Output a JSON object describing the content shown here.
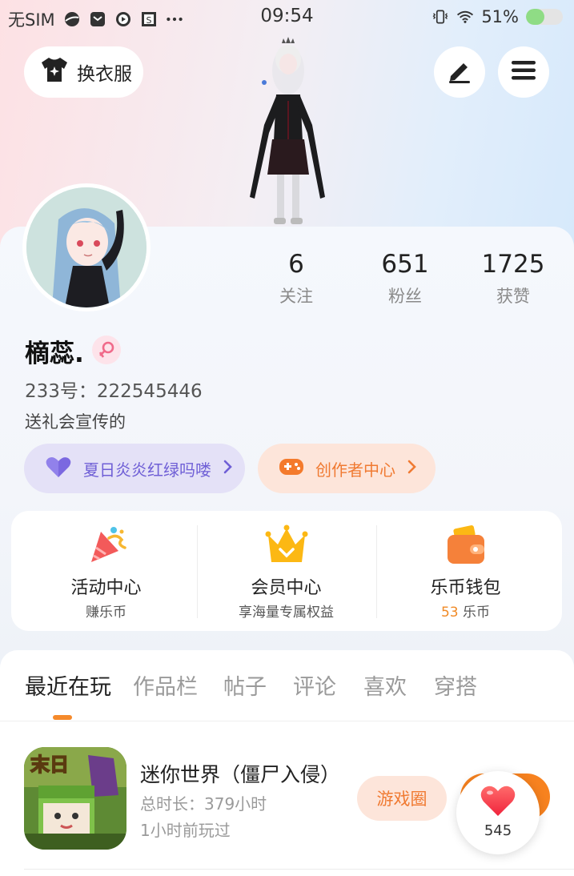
{
  "status_bar": {
    "carrier": "无SIM",
    "time": "09:54",
    "battery_percent": "51%",
    "battery_level": 0.51,
    "icons": [
      "planet-icon",
      "mail-icon",
      "play-icon",
      "s-app-icon",
      "more-dots-icon",
      "vibrate-icon",
      "wifi-icon",
      "battery-icon"
    ]
  },
  "header": {
    "outfit_label": "换衣服",
    "edit_icon": "pen-icon",
    "menu_icon": "hamburger-icon"
  },
  "profile": {
    "name": "樀蕊.",
    "gender": "female",
    "uid": "233号：222545446",
    "signature": "送礼会宣传的",
    "stats": [
      {
        "value": "6",
        "label": "关注"
      },
      {
        "value": "651",
        "label": "粉丝"
      },
      {
        "value": "1725",
        "label": "获赞"
      }
    ]
  },
  "pills": {
    "purple": "夏日炎炎红绿吗喽",
    "orange": "创作者中心"
  },
  "services": [
    {
      "title": "活动中心",
      "sub": "赚乐币",
      "icon": "party-popper-icon"
    },
    {
      "title": "会员中心",
      "sub": "享海量专属权益",
      "icon": "crown-icon"
    },
    {
      "title": "乐币钱包",
      "sub_num": "53",
      "sub_unit": "乐币",
      "icon": "wallet-icon"
    }
  ],
  "tabs": [
    "最近在玩",
    "作品栏",
    "帖子",
    "评论",
    "喜欢",
    "穿搭"
  ],
  "active_tab": "最近在玩",
  "game": {
    "title": "迷你世界（僵尸入侵）",
    "playtime": "总时长：379小时",
    "last_played": "1小时前玩过",
    "circle_button": "游戏圈",
    "likes": "545"
  },
  "colors": {
    "accent_orange": "#f58a2b",
    "purple": "#6f5fd6"
  }
}
